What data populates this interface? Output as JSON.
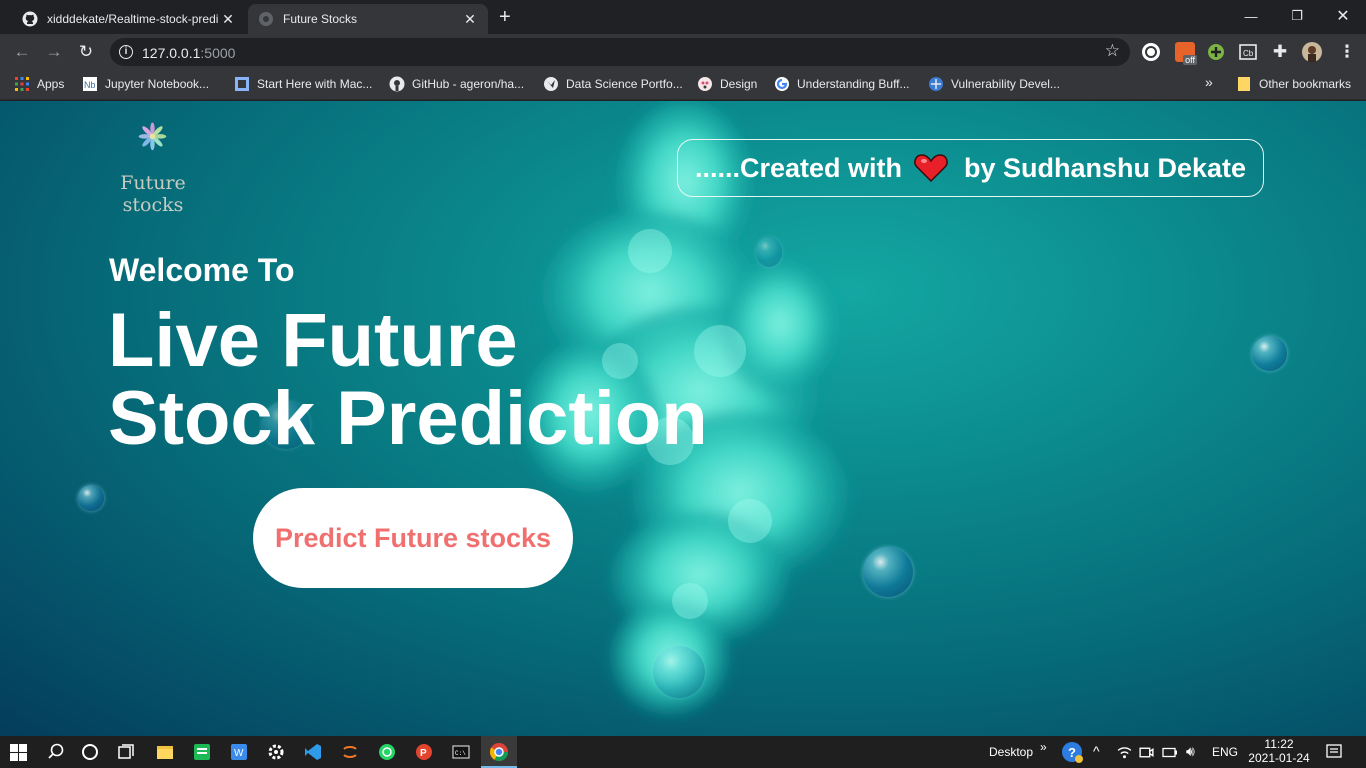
{
  "browser": {
    "tabs": [
      {
        "title": "xidddekate/Realtime-stock-predi",
        "active": false,
        "icon": "github-icon"
      },
      {
        "title": "Future Stocks",
        "active": true,
        "icon": "globe-icon"
      }
    ],
    "new_tab": "+",
    "url": {
      "host": "127.0.0.1",
      "port": ":5000"
    },
    "bookmarks": [
      {
        "label": "Apps",
        "icon": "apps-grid-icon"
      },
      {
        "label": "Jupyter Notebook...",
        "icon": "jupyter-icon"
      },
      {
        "label": "Start Here with Mac...",
        "icon": "page-icon"
      },
      {
        "label": "GitHub - ageron/ha...",
        "icon": "github-icon"
      },
      {
        "label": "Data Science Portfo...",
        "icon": "globe-icon"
      },
      {
        "label": "Design",
        "icon": "design-icon"
      },
      {
        "label": "Understanding Buff...",
        "icon": "google-icon"
      },
      {
        "label": "Vulnerability Devel...",
        "icon": "vuln-icon"
      }
    ],
    "bookmarks_more": "»",
    "other_bookmarks": "Other bookmarks",
    "extension_badge": "off"
  },
  "page": {
    "logo": {
      "line1": "Future",
      "line2": "stocks"
    },
    "credit": {
      "prefix": "......Created with",
      "suffix": "by Sudhanshu Dekate"
    },
    "welcome": "Welcome To",
    "headline": {
      "line1": "Live Future",
      "line2": "Stock Prediction"
    },
    "cta_label": "Predict Future stocks"
  },
  "taskbar": {
    "desktop_label": "Desktop",
    "desktop_chevron": "»",
    "language": "ENG",
    "time": "11:22",
    "date": "2021-01-24"
  },
  "colors": {
    "page_bg": "#0b8a8d",
    "cta_text": "#f07070",
    "heart": "#e8202a"
  }
}
